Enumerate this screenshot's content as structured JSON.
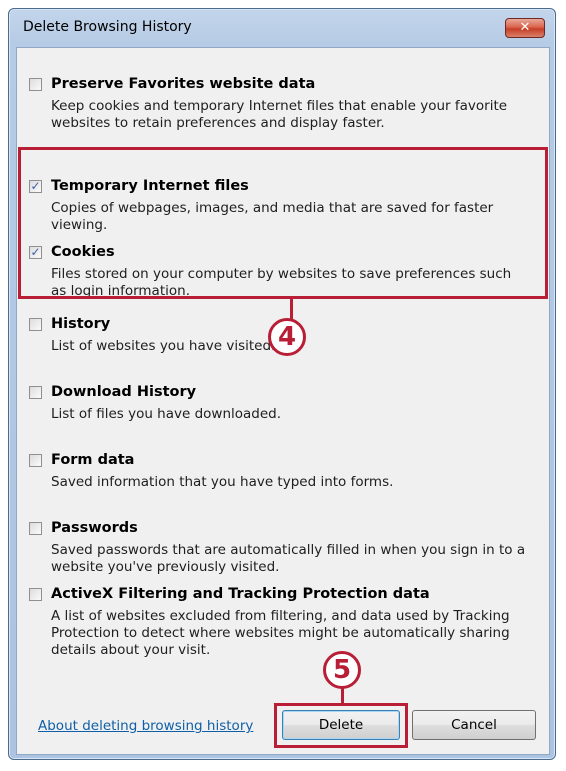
{
  "window": {
    "title": "Delete Browsing History",
    "close_label": "✕"
  },
  "items": [
    {
      "key": "Preserve Favorites website data",
      "checked": false,
      "desc": "Keep cookies and temporary Internet files that enable your favorite websites to retain preferences and display faster."
    },
    {
      "key": "Temporary Internet files",
      "checked": true,
      "desc": "Copies of webpages, images, and media that are saved for faster viewing."
    },
    {
      "key": "Cookies",
      "checked": true,
      "desc": "Files stored on your computer by websites to save preferences such as login information."
    },
    {
      "key": "History",
      "checked": false,
      "desc": "List of websites you have visited."
    },
    {
      "key": "Download History",
      "checked": false,
      "desc": "List of files you have downloaded."
    },
    {
      "key": "Form data",
      "checked": false,
      "desc": "Saved information that you have typed into forms."
    },
    {
      "key": "Passwords",
      "checked": false,
      "desc": "Saved passwords that are automatically filled in when you sign in to a website you've previously visited."
    },
    {
      "key": "ActiveX Filtering and Tracking Protection data",
      "checked": false,
      "desc": "A list of websites excluded from filtering, and data used by Tracking Protection to detect where websites might be automatically sharing details about your visit."
    }
  ],
  "footer": {
    "link_text": "About deleting browsing history",
    "delete_label": "Delete",
    "cancel_label": "Cancel"
  },
  "annotations": {
    "step4": "4",
    "step5": "5",
    "highlight_color": "#b81e36"
  },
  "check_glyph": "✓"
}
